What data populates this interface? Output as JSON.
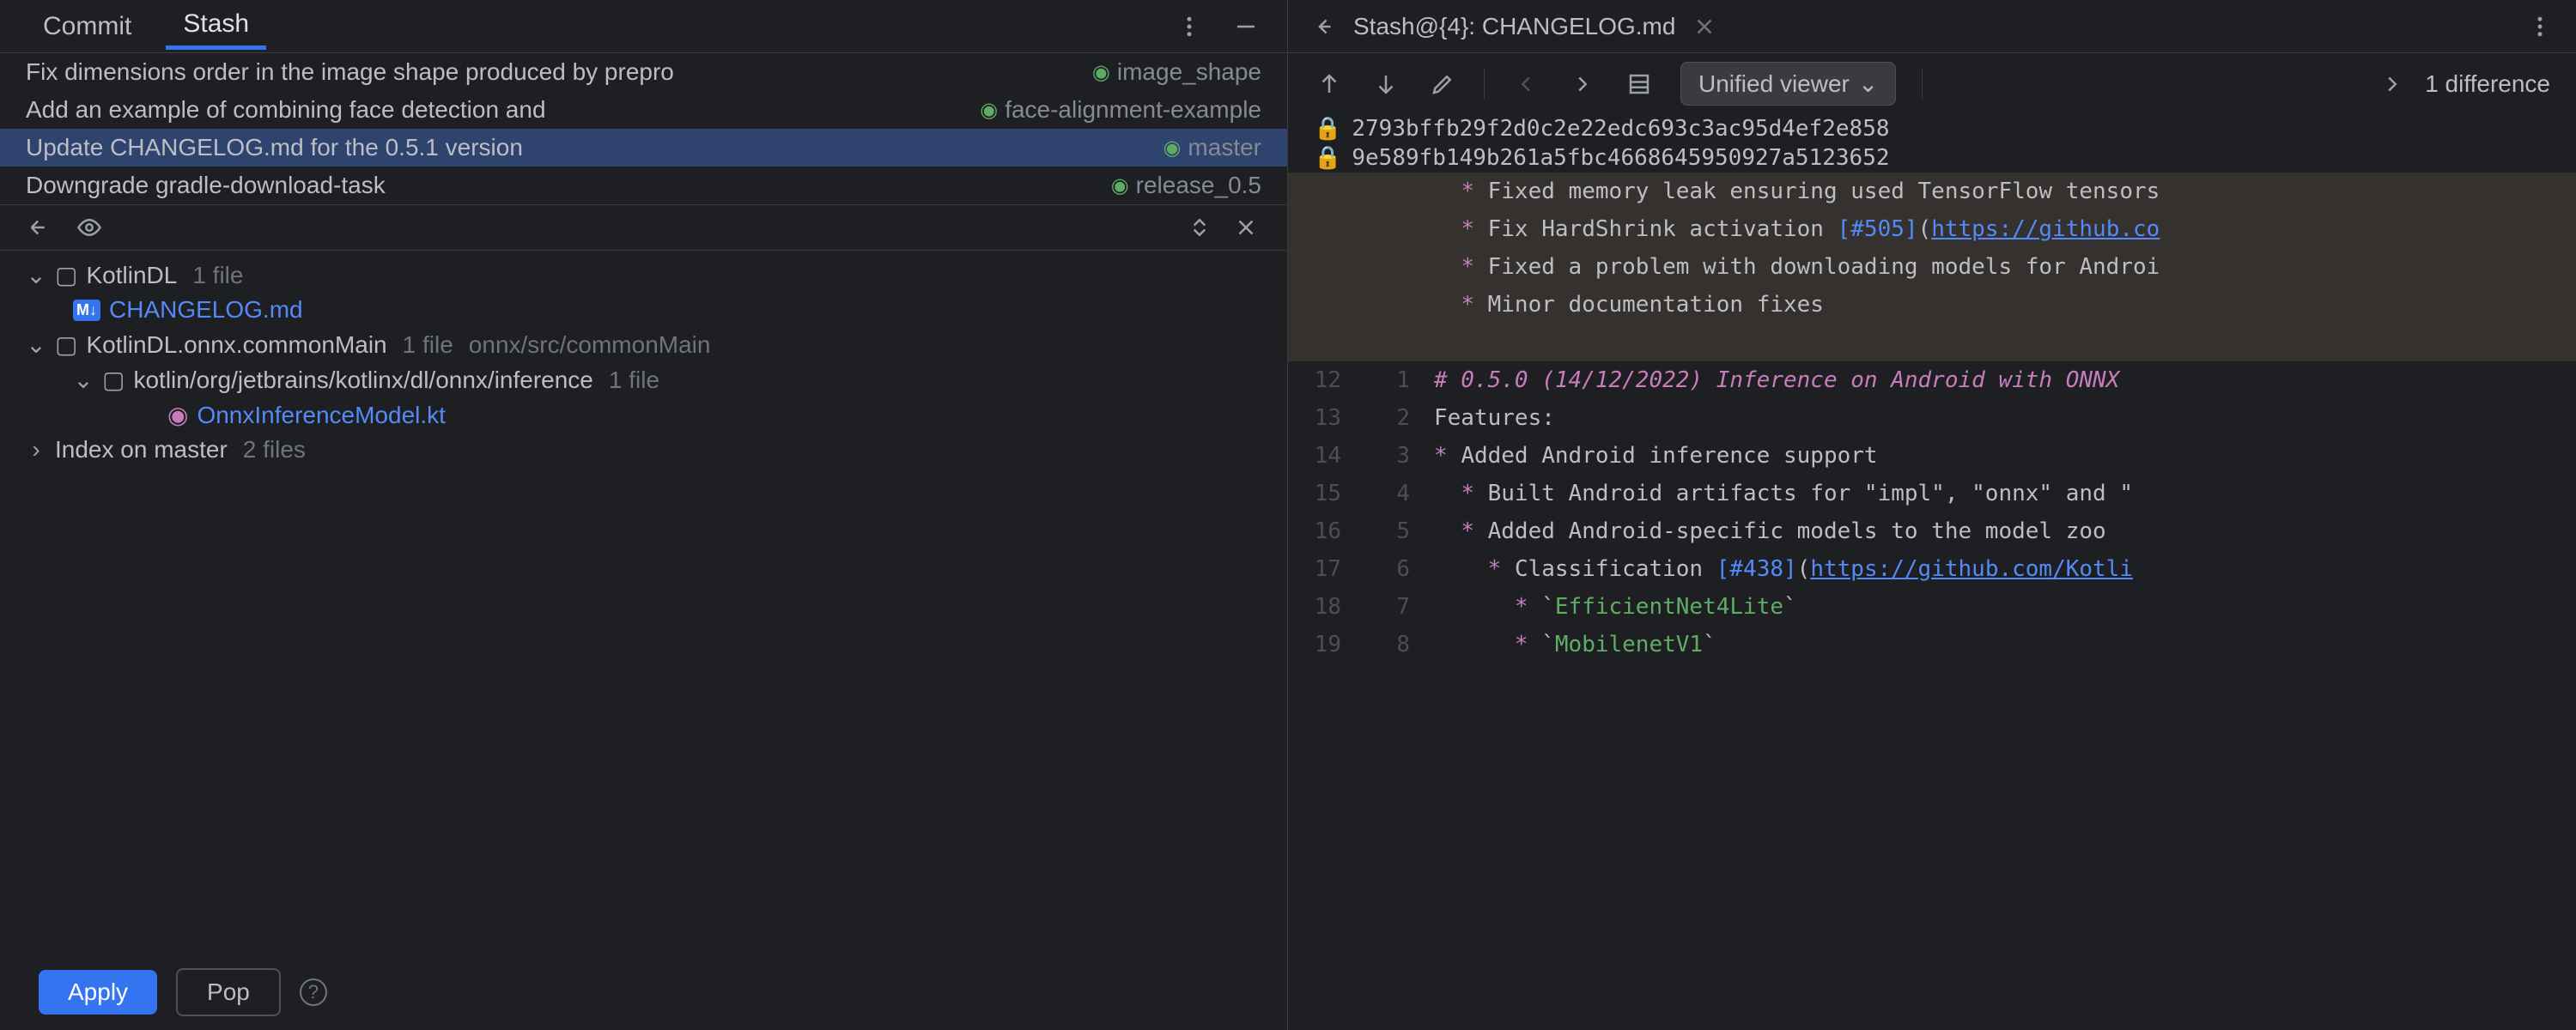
{
  "tabs": {
    "commit": "Commit",
    "stash": "Stash"
  },
  "stashes": [
    {
      "message": "Fix dimensions order in the image shape produced by prepro",
      "tag": "image_shape"
    },
    {
      "message": "Add an example of combining face detection and ",
      "tag": "face-alignment-example"
    },
    {
      "message": "Update CHANGELOG.md for the 0.5.1 version",
      "tag": "master"
    },
    {
      "message": "Downgrade gradle-download-task",
      "tag": "release_0.5"
    }
  ],
  "tree": {
    "root1": {
      "name": "KotlinDL",
      "info": "1 file"
    },
    "changelog": "CHANGELOG.md",
    "root2": {
      "name": "KotlinDL.onnx.commonMain",
      "info": "1 file",
      "path": "onnx/src/commonMain"
    },
    "pkg": {
      "name": "kotlin/org/jetbrains/kotlinx/dl/onnx/inference",
      "info": "1 file"
    },
    "ktfile": "OnnxInferenceModel.kt",
    "index": {
      "name": "Index on master",
      "info": "2 files"
    }
  },
  "buttons": {
    "apply": "Apply",
    "pop": "Pop"
  },
  "diff": {
    "title": "Stash@{4}: CHANGELOG.md",
    "viewer": "Unified viewer",
    "diffcount": "1 difference",
    "hash1": "2793bffb29f2d0c2e22edc693c3ac95d4ef2e858",
    "hash2": "9e589fb149b261a5fbc4668645950927a5123652"
  },
  "code": {
    "l1": "Fixed memory leak ensuring used TensorFlow tensors",
    "l2a": "Fix HardShrink activation ",
    "l2b": "[#505]",
    "l2c": "https://github.co",
    "l3": "Fixed a problem with downloading models for Androi",
    "l4": "Minor documentation fixes",
    "l5": "# 0.5.0 (14/12/2022) Inference on Android with ONNX",
    "l6": "Features:",
    "l7": "Added Android inference support",
    "l8": "Built Android artifacts for \"impl\", \"onnx\" and \"",
    "l9": "Added Android-specific models to the model zoo",
    "l10a": "Classification ",
    "l10b": "[#438]",
    "l10c": "https://github.com/Kotli",
    "l11": "EfficientNet4Lite",
    "l12": "MobilenetV1",
    "nums": {
      "r12": "12",
      "r13": "13",
      "r14": "14",
      "r15": "15",
      "r16": "16",
      "r17": "17",
      "r18": "18",
      "r19": "19",
      "n1": "1",
      "n2": "2",
      "n3": "3",
      "n4": "4",
      "n5": "5",
      "n6": "6",
      "n7": "7",
      "n8": "8"
    }
  }
}
